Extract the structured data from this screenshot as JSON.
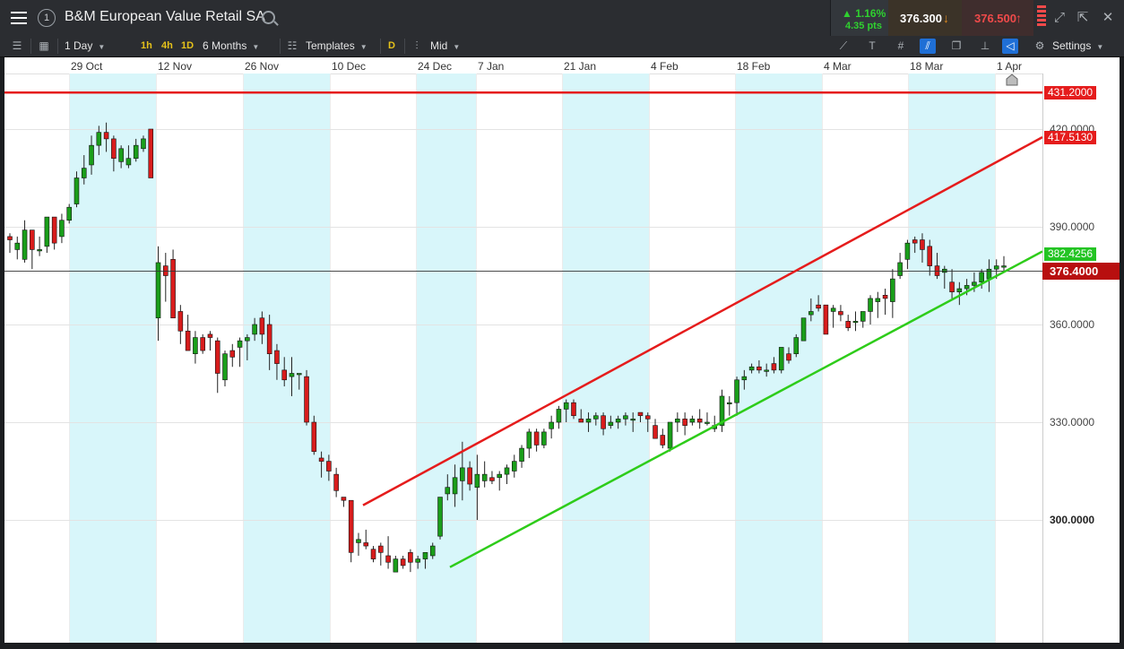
{
  "header": {
    "instrument": "B&M European Value Retail SA",
    "panel_number": "1",
    "change_pct": "▲ 1.16%",
    "change_pts": "4.35 pts",
    "sell_price": "376.300",
    "buy_price": "376.500",
    "colors": {
      "up": "#2fd12f",
      "sell_arrow": "#e08b1f",
      "buy": "#f04a4a"
    }
  },
  "toolbar": {
    "interval": "1 Day",
    "quick": [
      "1h",
      "4h",
      "1D"
    ],
    "range": "6 Months",
    "templates": "Templates",
    "d_badge": "D",
    "price_type": "Mid",
    "settings": "Settings"
  },
  "chart_data": {
    "type": "candlestick",
    "x_ticks": [
      "29 Oct",
      "12 Nov",
      "26 Nov",
      "10 Dec",
      "24 Dec",
      "7 Jan",
      "21 Jan",
      "4 Feb",
      "18 Feb",
      "4 Mar",
      "18 Mar",
      "1 Apr"
    ],
    "y_ticks": [
      "420.0000",
      "390.0000",
      "360.0000",
      "330.0000",
      "300.0000"
    ],
    "ylim": [
      275,
      428
    ],
    "levels": [
      {
        "label": "431.2000",
        "value": 431.2,
        "color": "#e51c1c"
      },
      {
        "label": "417.5130",
        "value": 417.513,
        "color": "#e51c1c"
      },
      {
        "label": "382.4256",
        "value": 382.4256,
        "color": "#24c424"
      },
      {
        "label": "376.4000",
        "value": 376.4,
        "color": "#b80f0f"
      }
    ],
    "current_price": 376.4,
    "horizontal_line": 431.2,
    "channel_upper": {
      "start": 304.5,
      "end": 417.513
    },
    "channel_lower": {
      "start": 285.5,
      "end": 382.4256
    },
    "candles": [
      [
        387,
        388,
        382,
        386
      ],
      [
        383,
        387,
        380,
        385
      ],
      [
        380,
        392,
        379,
        389
      ],
      [
        389,
        389,
        377,
        383
      ],
      [
        383,
        387,
        381,
        383
      ],
      [
        384,
        393,
        382,
        393
      ],
      [
        393,
        393,
        383,
        385
      ],
      [
        387,
        394,
        385,
        392
      ],
      [
        392,
        397,
        391,
        396
      ],
      [
        397,
        407,
        396,
        405
      ],
      [
        405,
        412,
        403,
        408
      ],
      [
        409,
        418,
        406,
        415
      ],
      [
        415,
        421,
        412,
        419
      ],
      [
        419,
        422,
        413,
        417
      ],
      [
        417,
        418,
        407,
        411
      ],
      [
        410,
        415,
        408,
        414
      ],
      [
        409,
        415,
        408,
        411
      ],
      [
        411,
        417,
        410,
        415
      ],
      [
        414,
        418,
        413,
        417
      ],
      [
        420,
        420,
        405,
        405
      ],
      [
        362,
        384,
        355,
        379
      ],
      [
        378,
        382,
        367,
        375
      ],
      [
        380,
        383,
        364,
        362
      ],
      [
        364,
        366,
        354,
        358
      ],
      [
        358,
        363,
        352,
        352
      ],
      [
        351,
        358,
        348,
        356
      ],
      [
        356,
        357,
        351,
        352
      ],
      [
        357,
        358,
        352,
        356
      ],
      [
        355,
        356,
        339,
        345
      ],
      [
        343,
        352,
        341,
        351
      ],
      [
        352,
        354,
        347,
        350
      ],
      [
        353,
        356,
        347,
        355
      ],
      [
        355,
        357,
        349,
        356
      ],
      [
        357,
        362,
        355,
        360
      ],
      [
        362,
        364,
        354,
        357
      ],
      [
        360,
        363,
        346,
        351
      ],
      [
        352,
        354,
        343,
        348
      ],
      [
        346,
        350,
        341,
        343
      ],
      [
        344,
        350,
        338,
        345
      ],
      [
        345,
        345,
        340,
        345
      ],
      [
        344,
        346,
        329,
        330
      ],
      [
        330,
        332,
        320,
        321
      ],
      [
        319,
        321,
        313,
        318
      ],
      [
        318,
        320,
        312,
        315
      ],
      [
        314,
        316,
        307,
        309
      ],
      [
        307,
        307,
        304,
        306
      ],
      [
        306,
        306,
        287,
        290
      ],
      [
        293,
        296,
        289,
        294
      ],
      [
        293,
        297,
        291,
        292
      ],
      [
        291,
        292,
        287,
        288
      ],
      [
        292,
        293,
        286,
        290
      ],
      [
        289,
        295,
        285,
        287
      ],
      [
        284,
        289,
        284,
        288
      ],
      [
        288,
        289,
        285,
        286
      ],
      [
        290,
        291,
        284,
        287
      ],
      [
        287,
        289,
        285,
        288
      ],
      [
        288,
        290,
        285,
        290
      ],
      [
        289,
        293,
        288,
        292
      ],
      [
        295,
        307,
        294,
        307
      ],
      [
        308,
        314,
        306,
        310
      ],
      [
        308,
        317,
        304,
        313
      ],
      [
        312,
        324,
        306,
        316
      ],
      [
        316,
        318,
        309,
        311
      ],
      [
        310,
        320,
        300,
        314
      ],
      [
        312,
        318,
        310,
        314
      ],
      [
        313,
        315,
        311,
        312
      ],
      [
        313,
        315,
        309,
        314
      ],
      [
        314,
        317,
        311,
        316
      ],
      [
        315,
        320,
        313,
        318
      ],
      [
        318,
        323,
        316,
        322
      ],
      [
        322,
        328,
        319,
        327
      ],
      [
        327,
        328,
        321,
        323
      ],
      [
        323,
        328,
        322,
        327
      ],
      [
        328,
        332,
        325,
        330
      ],
      [
        330,
        335,
        328,
        334
      ],
      [
        334,
        337,
        330,
        336
      ],
      [
        336,
        337,
        331,
        332
      ],
      [
        331,
        334,
        330,
        330
      ],
      [
        330,
        333,
        327,
        331
      ],
      [
        331,
        333,
        329,
        332
      ],
      [
        332,
        333,
        326,
        328
      ],
      [
        329,
        332,
        328,
        330
      ],
      [
        330,
        332,
        328,
        331
      ],
      [
        331,
        333,
        329,
        332
      ],
      [
        331,
        333,
        327,
        331
      ],
      [
        333,
        333,
        330,
        332
      ],
      [
        332,
        333,
        327,
        331
      ],
      [
        329,
        331,
        325,
        325
      ],
      [
        326,
        328,
        322,
        323
      ],
      [
        322,
        330,
        321,
        330
      ],
      [
        330,
        333,
        327,
        331
      ],
      [
        331,
        333,
        326,
        329
      ],
      [
        330,
        332,
        329,
        331
      ],
      [
        331,
        334,
        328,
        330
      ],
      [
        330,
        333,
        329,
        330
      ],
      [
        328,
        332,
        327,
        329
      ],
      [
        329,
        340,
        327,
        338
      ],
      [
        336,
        338,
        332,
        336
      ],
      [
        336,
        344,
        332,
        343
      ],
      [
        343,
        346,
        340,
        344
      ],
      [
        346,
        348,
        345,
        347
      ],
      [
        347,
        349,
        345,
        346
      ],
      [
        346,
        348,
        344,
        346
      ],
      [
        348,
        350,
        345,
        346
      ],
      [
        346,
        353,
        345,
        353
      ],
      [
        351,
        353,
        348,
        349
      ],
      [
        351,
        357,
        350,
        356
      ],
      [
        355,
        362,
        355,
        362
      ],
      [
        363,
        368,
        361,
        364
      ],
      [
        366,
        369,
        364,
        365
      ],
      [
        366,
        366,
        357,
        357
      ],
      [
        364,
        366,
        359,
        365
      ],
      [
        364,
        366,
        361,
        363
      ],
      [
        361,
        363,
        358,
        359
      ],
      [
        361,
        364,
        358,
        361
      ],
      [
        361,
        364,
        359,
        364
      ],
      [
        364,
        369,
        360,
        368
      ],
      [
        367,
        370,
        362,
        368
      ],
      [
        369,
        371,
        363,
        368
      ],
      [
        367,
        377,
        362,
        374
      ],
      [
        375,
        382,
        374,
        379
      ],
      [
        380,
        386,
        377,
        385
      ],
      [
        386,
        387,
        382,
        385
      ],
      [
        386,
        388,
        379,
        383
      ],
      [
        384,
        386,
        375,
        378
      ],
      [
        378,
        382,
        374,
        375
      ],
      [
        376,
        378,
        371,
        377
      ],
      [
        373,
        377,
        368,
        370
      ],
      [
        370,
        373,
        366,
        371
      ],
      [
        371,
        374,
        369,
        372
      ],
      [
        372,
        376,
        370,
        373
      ],
      [
        373,
        377,
        371,
        376
      ],
      [
        374,
        380,
        370,
        377
      ],
      [
        377,
        380,
        374,
        378
      ],
      [
        378,
        381,
        376,
        378
      ]
    ]
  }
}
